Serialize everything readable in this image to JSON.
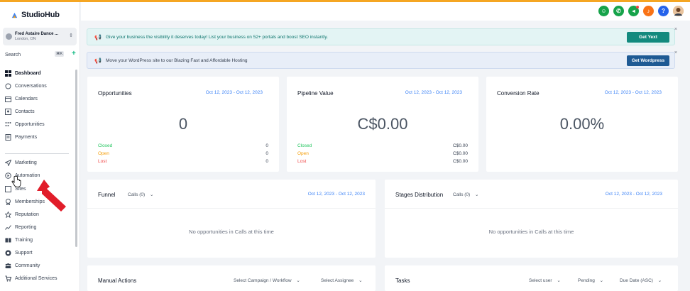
{
  "app": {
    "name": "StudioHub"
  },
  "account": {
    "name": "Fred Astaire Dance ...",
    "location": "London, ON"
  },
  "search": {
    "label": "Search",
    "shortcut": "⌘K"
  },
  "sidebar": {
    "primary": [
      {
        "label": "Dashboard",
        "icon": "dashboard-icon",
        "active": true
      },
      {
        "label": "Conversations",
        "icon": "chat-icon"
      },
      {
        "label": "Calendars",
        "icon": "calendar-icon"
      },
      {
        "label": "Contacts",
        "icon": "contacts-icon"
      },
      {
        "label": "Opportunities",
        "icon": "opportunities-icon"
      },
      {
        "label": "Payments",
        "icon": "payments-icon"
      }
    ],
    "secondary": [
      {
        "label": "Marketing",
        "icon": "send-icon"
      },
      {
        "label": "Automation",
        "icon": "automation-icon"
      },
      {
        "label": "Sites",
        "icon": "sites-icon"
      },
      {
        "label": "Memberships",
        "icon": "membership-icon"
      },
      {
        "label": "Reputation",
        "icon": "star-icon"
      },
      {
        "label": "Reporting",
        "icon": "chart-line-icon"
      },
      {
        "label": "Training",
        "icon": "book-icon"
      },
      {
        "label": "Support",
        "icon": "support-icon"
      },
      {
        "label": "Community",
        "icon": "community-icon"
      },
      {
        "label": "Additional Services",
        "icon": "cart-icon"
      }
    ]
  },
  "header_icons": [
    {
      "name": "support-agent-icon",
      "color": "#16a34a"
    },
    {
      "name": "phone-icon",
      "color": "#16a34a"
    },
    {
      "name": "announcement-icon",
      "color": "#16a34a"
    },
    {
      "name": "notification-icon",
      "color": "#f97316"
    },
    {
      "name": "help-icon",
      "color": "#2563eb"
    },
    {
      "name": "user-avatar",
      "color": "#f59e0b"
    }
  ],
  "banners": [
    {
      "text": "Give your business the visibility it deserves today! List your business on 52+ portals and boost SEO instantly.",
      "button": "Get Yext"
    },
    {
      "text": "Move your WordPress site to our Blazing Fast and Affordable Hosting",
      "button": "Get Wordpress"
    }
  ],
  "cards": {
    "opportunities": {
      "title": "Opportunities",
      "date": "Oct 12, 2023 - Oct 12, 2023",
      "value": "0",
      "stats": [
        {
          "label": "Closed",
          "value": "0"
        },
        {
          "label": "Open",
          "value": "0"
        },
        {
          "label": "Lost",
          "value": "0"
        }
      ]
    },
    "pipeline": {
      "title": "Pipeline Value",
      "date": "Oct 12, 2023 - Oct 12, 2023",
      "value": "C$0.00",
      "stats": [
        {
          "label": "Closed",
          "value": "C$0.00"
        },
        {
          "label": "Open",
          "value": "C$0.00"
        },
        {
          "label": "Lost",
          "value": "C$0.00"
        }
      ]
    },
    "conversion": {
      "title": "Conversion Rate",
      "date": "Oct 12, 2023 - Oct 12, 2023",
      "value": "0.00%"
    },
    "funnel": {
      "title": "Funnel",
      "filter": "Calls (0)",
      "date": "Oct 12, 2023 - Oct 12, 2023",
      "empty": "No opportunities in Calls at this time"
    },
    "stages": {
      "title": "Stages Distribution",
      "filter": "Calls (0)",
      "date": "Oct 12, 2023 - Oct 12, 2023",
      "empty": "No opportunities in Calls at this time"
    },
    "manual_actions": {
      "title": "Manual Actions",
      "filter1": "Select Campaign / Workflow",
      "filter2": "Select Assignee"
    },
    "tasks": {
      "title": "Tasks",
      "filter1": "Select user",
      "filter2": "Pending",
      "filter3": "Due Date (ASC)"
    }
  },
  "colors": {
    "accent_teal": "#138a7e",
    "accent_blue": "#1e5a94",
    "link_blue": "#3b82f6",
    "closed": "#22c55e",
    "open": "#f59e0b",
    "lost": "#ef4444",
    "top_strip": "#f5a623"
  }
}
